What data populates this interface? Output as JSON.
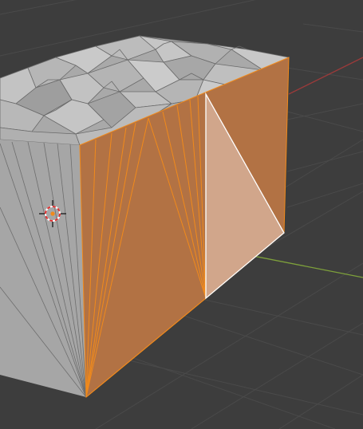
{
  "viewport": {
    "kind": "blender-3d-viewport",
    "mode": "edit-mode-face-select"
  },
  "colors": {
    "background": "#3d3d3d",
    "grid_line": "#4a4a4a",
    "x_axis": "#9b3a3a",
    "y_axis": "#7ea13b",
    "mesh_light": "#c3c3c3",
    "mesh_mid": "#a9a9a9",
    "mesh_dark": "#8f8f8f",
    "mesh_edge": "#6a6a6a",
    "selected_face": "#b27244",
    "selected_edge": "#f08a1c",
    "active_face": "#d1a68b",
    "active_edge": "#ffffff",
    "cursor_ring_red": "#e03030",
    "cursor_ring_white": "#ffffff"
  },
  "elements": {
    "mesh_object": "displaced-cube",
    "selected_face": "front-right-side-face",
    "active_face": "triangle-face",
    "cursor": "3d-cursor-icon"
  }
}
